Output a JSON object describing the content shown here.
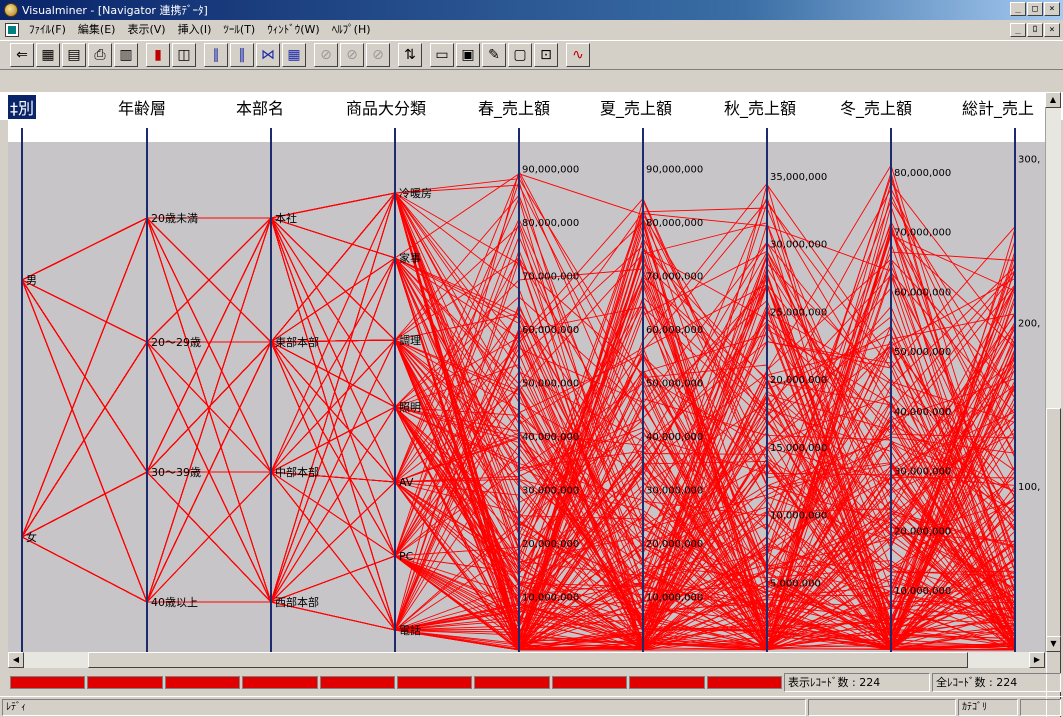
{
  "window": {
    "title": "Visualminer - [Navigator 連携ﾃﾞｰﾀ]",
    "minimize_symbol": "_",
    "maximize_symbol": "□",
    "close_symbol": "×",
    "restore_symbol": "ﾛ"
  },
  "menu": [
    {
      "label": "ﾌｧｲﾙ(F)"
    },
    {
      "label": "編集(E)"
    },
    {
      "label": "表示(V)"
    },
    {
      "label": "挿入(I)"
    },
    {
      "label": "ﾂｰﾙ(T)"
    },
    {
      "label": "ｳｨﾝﾄﾞｳ(W)"
    },
    {
      "label": "ﾍﾙﾌﾟ(H)"
    }
  ],
  "toolbar": {
    "buttons": [
      {
        "icon": "open-icon",
        "glyph": "⇐"
      },
      {
        "icon": "save-icon",
        "glyph": "▦"
      },
      {
        "icon": "copy-icon",
        "glyph": "▤"
      },
      {
        "icon": "print-icon",
        "glyph": "⎙"
      },
      {
        "icon": "preview-icon",
        "glyph": "▥"
      },
      {
        "icon": "bar-chart-icon",
        "glyph": "▮"
      },
      {
        "icon": "window-icon",
        "glyph": "◫"
      },
      {
        "icon": "parallel-coords-icon",
        "glyph": "∥"
      },
      {
        "icon": "parallel-blue-icon",
        "glyph": "‖"
      },
      {
        "icon": "axis-icon",
        "glyph": "⋈"
      },
      {
        "icon": "table-icon",
        "glyph": "▦"
      },
      {
        "icon": "filter-icon",
        "glyph": "⊘"
      },
      {
        "icon": "filter2-icon",
        "glyph": "⊘"
      },
      {
        "icon": "filter3-icon",
        "glyph": "⊘"
      },
      {
        "icon": "sort-icon",
        "glyph": "⇅"
      },
      {
        "icon": "chart-icon",
        "glyph": "▭"
      },
      {
        "icon": "image-icon",
        "glyph": "▣"
      },
      {
        "icon": "pen-icon",
        "glyph": "✎"
      },
      {
        "icon": "frame-icon",
        "glyph": "▢"
      },
      {
        "icon": "zoom-icon",
        "glyph": "⊡"
      },
      {
        "icon": "data-icon",
        "glyph": "∿"
      }
    ]
  },
  "columns": [
    {
      "label": "性別",
      "visible_label": "‡別",
      "selected": true
    },
    {
      "label": "年齢層"
    },
    {
      "label": "本部名"
    },
    {
      "label": "商品大分類"
    },
    {
      "label": "春_売上額"
    },
    {
      "label": "夏_売上額"
    },
    {
      "label": "秋_売上額"
    },
    {
      "label": "冬_売上額"
    },
    {
      "label": "総計_売上"
    }
  ],
  "chart_data": {
    "type": "parallel-coordinates",
    "axes": [
      {
        "name": "性別",
        "kind": "category",
        "categories": [
          "男",
          "女"
        ]
      },
      {
        "name": "年齢層",
        "kind": "category",
        "categories": [
          "20歳未満",
          "20～29歳",
          "30～39歳",
          "40歳以上"
        ]
      },
      {
        "name": "本部名",
        "kind": "category",
        "categories": [
          "本社",
          "東部本部",
          "中部本部",
          "西部本部"
        ]
      },
      {
        "name": "商品大分類",
        "kind": "category",
        "categories": [
          "冷暖房",
          "家事",
          "調理",
          "照明",
          "AV",
          "PC",
          "電話"
        ]
      },
      {
        "name": "春_売上額",
        "kind": "numeric",
        "ylim": [
          0,
          95000000
        ],
        "ticks": [
          "90,000,000",
          "80,000,000",
          "70,000,000",
          "60,000,000",
          "50,000,000",
          "40,000,000",
          "30,000,000",
          "20,000,000",
          "10,000,000"
        ]
      },
      {
        "name": "夏_売上額",
        "kind": "numeric",
        "ylim": [
          0,
          95000000
        ],
        "ticks": [
          "90,000,000",
          "80,000,000",
          "70,000,000",
          "60,000,000",
          "50,000,000",
          "40,000,000",
          "30,000,000",
          "20,000,000",
          "10,000,000"
        ]
      },
      {
        "name": "秋_売上額",
        "kind": "numeric",
        "ylim": [
          0,
          37500000
        ],
        "ticks": [
          "35,000,000",
          "30,000,000",
          "25,000,000",
          "20,000,000",
          "15,000,000",
          "10,000,000",
          "5,000,000"
        ]
      },
      {
        "name": "冬_売上額",
        "kind": "numeric",
        "ylim": [
          0,
          85000000
        ],
        "ticks": [
          "80,000,000",
          "70,000,000",
          "60,000,000",
          "50,000,000",
          "40,000,000",
          "30,000,000",
          "20,000,000",
          "10,000,000"
        ]
      },
      {
        "name": "総計_売上",
        "kind": "numeric",
        "ylim": [
          0,
          310
        ],
        "ticks": [
          "300,",
          "200,",
          "100,"
        ]
      }
    ],
    "line_color": "#ff0000",
    "record_count": 224
  },
  "status": {
    "displayed_records": "表示ﾚｺｰﾄﾞ数 : 224",
    "total_records": "全ﾚｺｰﾄﾞ数 : 224",
    "ready": "ﾚﾃﾞｨ",
    "category": "ｶﾃｺﾞﾘ",
    "progress_segments": 10,
    "progress": 1.0
  },
  "colors": {
    "plot_background": "#c8c5c8",
    "axis": "#1c2a6e",
    "line": "#ff0000",
    "title_bar": "#0a246a"
  }
}
